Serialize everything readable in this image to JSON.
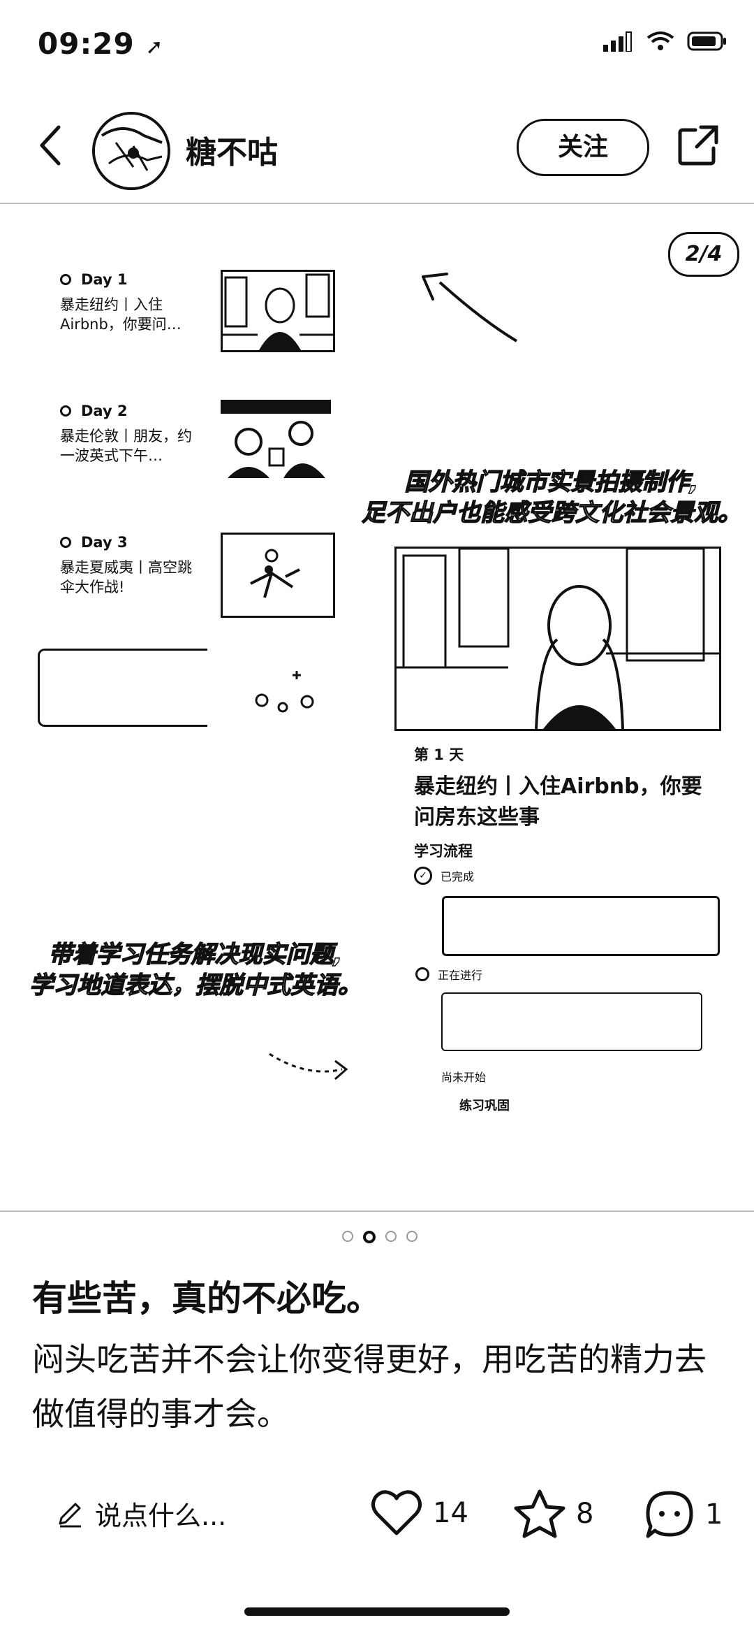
{
  "status_bar": {
    "time": "09:29"
  },
  "header": {
    "username": "糖不咕",
    "follow_label": "关注"
  },
  "carousel": {
    "counter": "2/4",
    "days": [
      {
        "label": "Day 1",
        "desc": "暴走纽约丨入住Airbnb，你要问…"
      },
      {
        "label": "Day 2",
        "desc": "暴走伦敦丨朋友，约一波英式下午…"
      },
      {
        "label": "Day 3",
        "desc": "暴走夏威夷丨高空跳伞大作战!"
      }
    ],
    "caption_top": [
      "国外热门城市实景拍摄制作,",
      "足不出户也能感受跨文化社会景观。"
    ],
    "caption_bottom": [
      "带着学习任务解决现实问题,",
      "学习地道表达，摆脱中式英语。"
    ],
    "phone": {
      "day_label": "第 1 天",
      "title": "暴走纽约丨入住Airbnb，你要问房东这些事",
      "flow_title": "学习流程",
      "status_done": "已完成",
      "status_running": "正在进行",
      "status_pending": "尚未开始",
      "practice": "练习巩固"
    },
    "page_dots": 4,
    "active_dot": 1
  },
  "post": {
    "title": "有些苦，真的不必吃。",
    "body": "闷头吃苦并不会让你变得更好，用吃苦的精力去做值得的事才会。"
  },
  "actions": {
    "comment_placeholder": "说点什么...",
    "likes": "14",
    "stars": "8",
    "comments": "1"
  }
}
